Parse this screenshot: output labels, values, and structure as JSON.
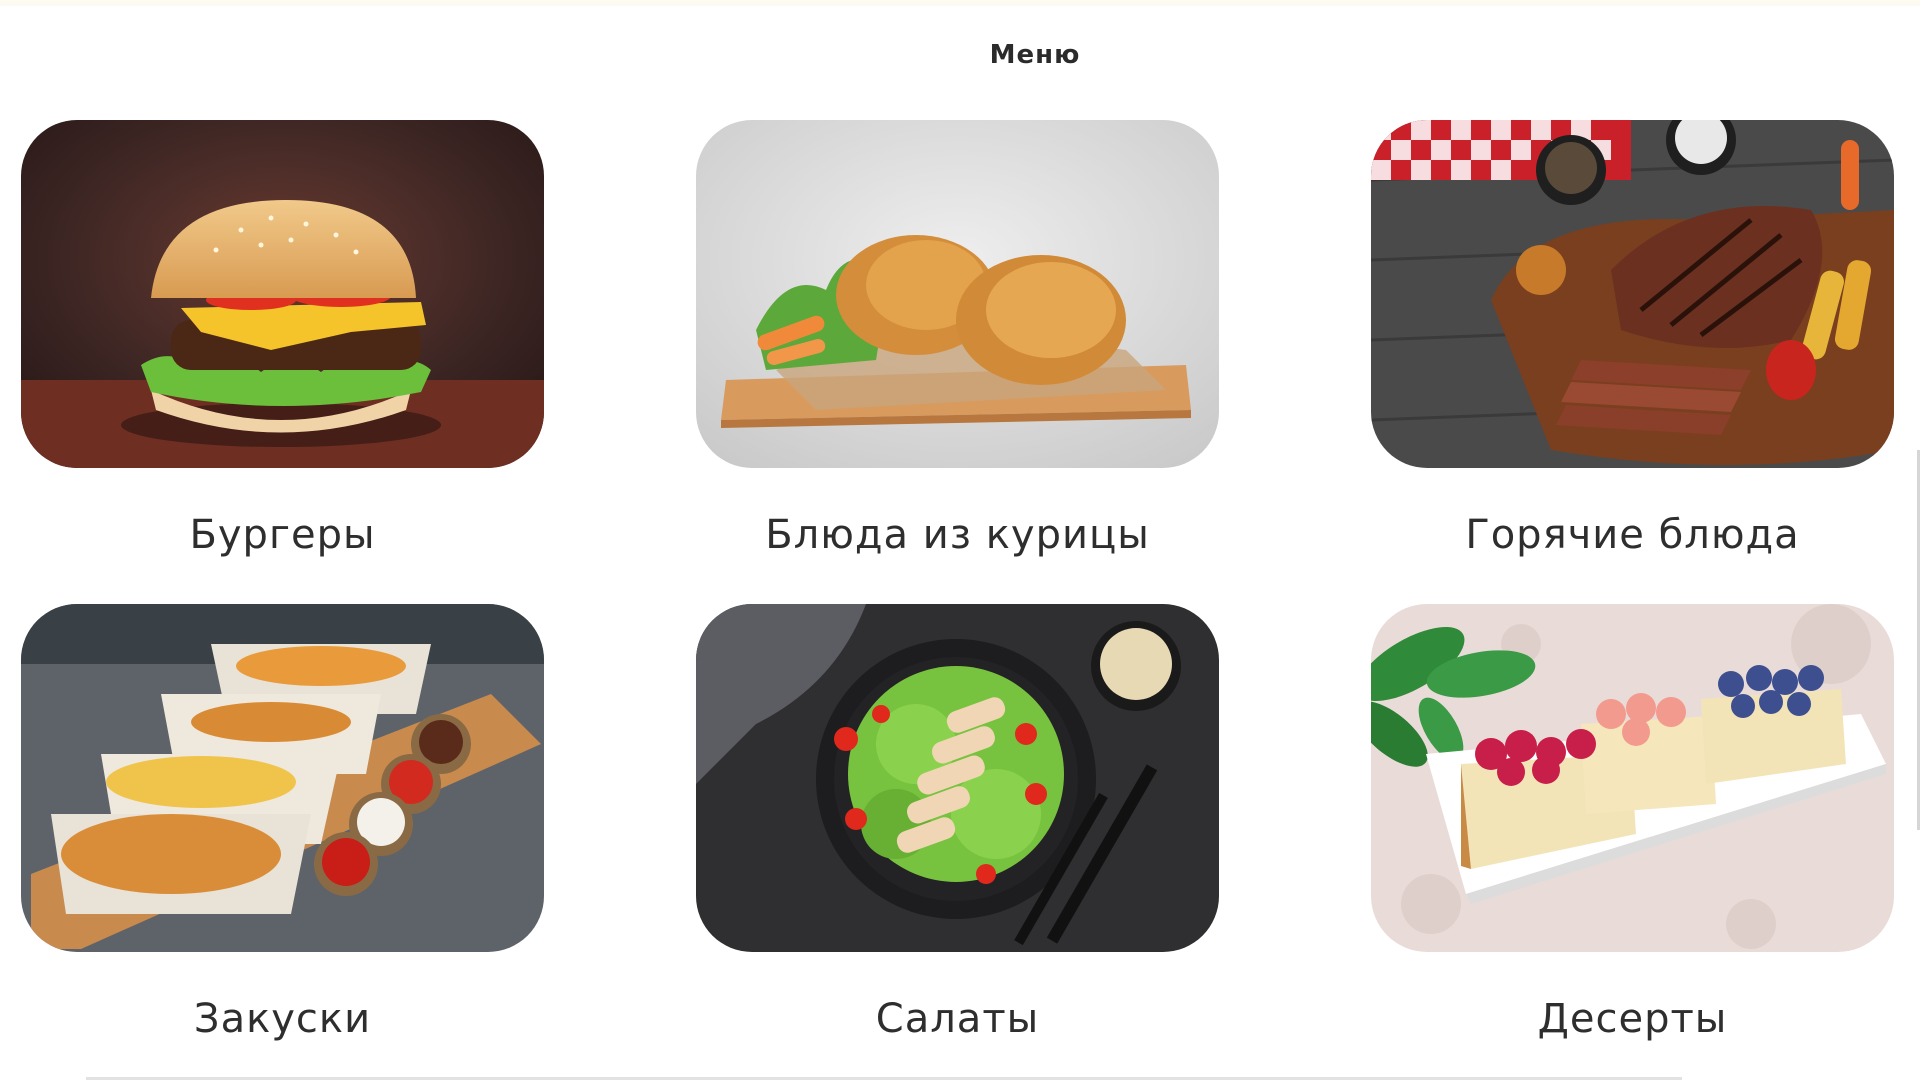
{
  "page": {
    "title": "Меню"
  },
  "menu": {
    "categories": [
      {
        "label": "Бургеры",
        "icon": "burger-photo"
      },
      {
        "label": "Блюда из курицы",
        "icon": "fried-chicken-photo"
      },
      {
        "label": "Горячие блюда",
        "icon": "grilled-steak-photo"
      },
      {
        "label": "Закуски",
        "icon": "snacks-photo"
      },
      {
        "label": "Салаты",
        "icon": "salad-photo"
      },
      {
        "label": "Десерты",
        "icon": "desserts-photo"
      }
    ]
  },
  "colors": {
    "background": "#ffffff",
    "text": "#2e2e2e",
    "divider": "#e2e2e2"
  }
}
